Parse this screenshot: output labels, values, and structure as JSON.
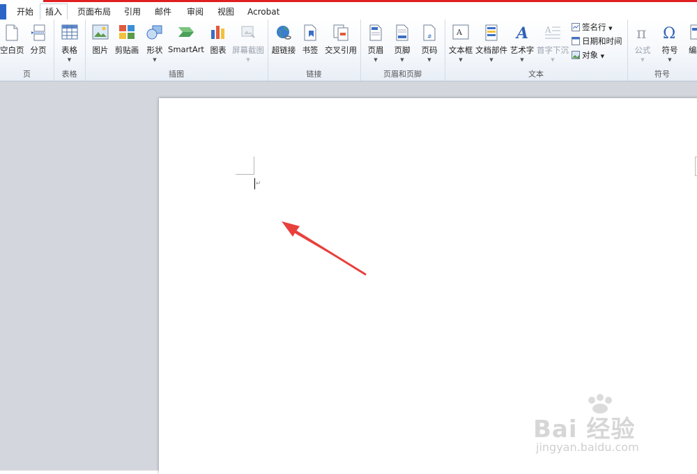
{
  "tabs": [
    "开始",
    "插入",
    "页面布局",
    "引用",
    "邮件",
    "审阅",
    "视图",
    "Acrobat"
  ],
  "active_tab": "插入",
  "groups": {
    "pages": {
      "label": "页",
      "buttons": {
        "blank_page": "空白页",
        "page_break": "分页"
      }
    },
    "tables": {
      "label": "表格",
      "buttons": {
        "table": "表格"
      }
    },
    "illustrations": {
      "label": "插图",
      "buttons": {
        "picture": "图片",
        "clipart": "剪贴画",
        "shapes": "形状",
        "smartart": "SmartArt",
        "chart": "图表",
        "screenshot": "屏幕截图"
      }
    },
    "links": {
      "label": "链接",
      "buttons": {
        "hyperlink": "超链接",
        "bookmark": "书签",
        "cross_reference": "交叉引用"
      }
    },
    "header_footer": {
      "label": "页眉和页脚",
      "buttons": {
        "header": "页眉",
        "footer": "页脚",
        "page_number": "页码"
      }
    },
    "text": {
      "label": "文本",
      "buttons": {
        "textbox": "文本框",
        "quick_parts": "文档部件",
        "wordart": "艺术字",
        "dropcap": "首字下沉",
        "signature_line": "签名行",
        "date_time": "日期和时间",
        "object": "对象"
      }
    },
    "symbols": {
      "label": "符号",
      "buttons": {
        "equation": "公式",
        "symbol": "符号",
        "numbering": "编号"
      }
    }
  },
  "document": {
    "paragraph_mark": "↵"
  },
  "watermark": {
    "brand": "Bai  经验",
    "url": "jingyan.baidu.com"
  },
  "colors": {
    "annotation_arrow": "#e8403c",
    "top_accent": "#e02020",
    "file_tab": "#2b66c7"
  },
  "annotation": "arrow pointing at text cursor"
}
